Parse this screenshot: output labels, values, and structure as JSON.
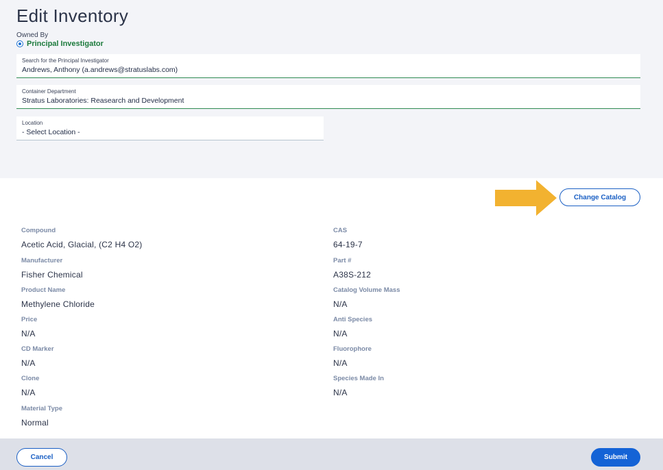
{
  "page": {
    "title": "Edit Inventory"
  },
  "owned_by": {
    "label": "Owned By",
    "selected_option": "Principal Investigator"
  },
  "fields": {
    "pi_search": {
      "label": "Search for the Principal Investigator",
      "value": "Andrews, Anthony (a.andrews@stratuslabs.com)"
    },
    "department": {
      "label": "Container Department",
      "value": "Stratus Laboratories: Reasearch and Development"
    },
    "location": {
      "label": "Location",
      "value": "- Select Location -"
    }
  },
  "actions": {
    "change_catalog": "Change Catalog",
    "cancel": "Cancel",
    "submit": "Submit"
  },
  "details_left": [
    {
      "label": "Compound",
      "value": "Acetic Acid, Glacial, (C2 H4 O2)"
    },
    {
      "label": "Manufacturer",
      "value": "Fisher Chemical"
    },
    {
      "label": "Product Name",
      "value": "Methylene Chloride"
    },
    {
      "label": "Price",
      "value": "N/A"
    },
    {
      "label": "CD Marker",
      "value": "N/A"
    },
    {
      "label": "Clone",
      "value": "N/A"
    },
    {
      "label": "Material Type",
      "value": "Normal"
    }
  ],
  "details_right": [
    {
      "label": "CAS",
      "value": "64-19-7"
    },
    {
      "label": "Part #",
      "value": "A38S-212"
    },
    {
      "label": "Catalog Volume Mass",
      "value": "N/A"
    },
    {
      "label": "Anti Species",
      "value": "N/A"
    },
    {
      "label": "Fluorophore",
      "value": "N/A"
    },
    {
      "label": "Species Made In",
      "value": "N/A"
    }
  ],
  "colors": {
    "accent": "#1463d6",
    "highlight_arrow": "#f2b230",
    "valid_underline": "#2f8a52",
    "owner_text": "#1c7a3c"
  }
}
